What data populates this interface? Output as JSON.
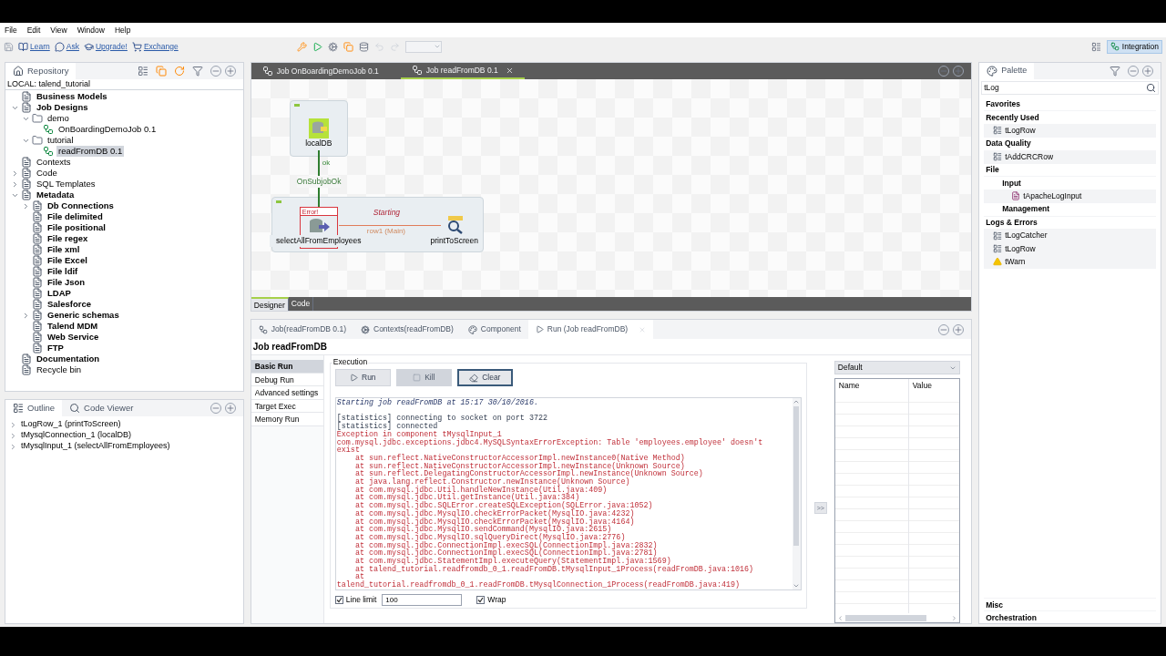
{
  "menu": [
    "File",
    "Edit",
    "View",
    "Window",
    "Help"
  ],
  "toolbar": {
    "links": [
      "Learn",
      "Ask",
      "Upgrade!",
      "Exchange"
    ],
    "perspective": {
      "label": "Integration",
      "selected": true
    }
  },
  "repository": {
    "title": "Repository",
    "project": "LOCAL: talend_tutorial",
    "tree": [
      {
        "label": "Business Models",
        "bold": true,
        "kind": "node",
        "selected": false
      },
      {
        "label": "Job Designs",
        "bold": true,
        "kind": "node",
        "selected": false,
        "expanded": true,
        "children": [
          {
            "label": "demo",
            "bold": false,
            "kind": "folder",
            "selected": false,
            "expanded": true,
            "children": [
              {
                "label": "OnBoardingDemoJob 0.1",
                "bold": false,
                "kind": "job",
                "selected": false
              }
            ]
          },
          {
            "label": "tutorial",
            "bold": false,
            "kind": "folder",
            "selected": false,
            "expanded": true,
            "children": [
              {
                "label": "readFromDB 0.1",
                "bold": false,
                "kind": "job",
                "selected": true
              }
            ]
          }
        ]
      },
      {
        "label": "Contexts",
        "bold": false,
        "kind": "node",
        "selected": false
      },
      {
        "label": "Code",
        "bold": false,
        "kind": "node",
        "selected": false,
        "expanded": false
      },
      {
        "label": "SQL Templates",
        "bold": false,
        "kind": "node",
        "selected": false,
        "expanded": false
      },
      {
        "label": "Metadata",
        "bold": true,
        "kind": "node",
        "selected": false,
        "expanded": true,
        "children": [
          {
            "label": "Db Connections",
            "bold": true,
            "kind": "node",
            "selected": false,
            "expanded": false
          },
          {
            "label": "File delimited",
            "bold": true,
            "kind": "node",
            "selected": false
          },
          {
            "label": "File positional",
            "bold": true,
            "kind": "node",
            "selected": false
          },
          {
            "label": "File regex",
            "bold": true,
            "kind": "node",
            "selected": false
          },
          {
            "label": "File xml",
            "bold": true,
            "kind": "node",
            "selected": false
          },
          {
            "label": "File Excel",
            "bold": true,
            "kind": "node",
            "selected": false
          },
          {
            "label": "File ldif",
            "bold": true,
            "kind": "node",
            "selected": false
          },
          {
            "label": "File Json",
            "bold": true,
            "kind": "node",
            "selected": false
          },
          {
            "label": "LDAP",
            "bold": true,
            "kind": "node",
            "selected": false
          },
          {
            "label": "Salesforce",
            "bold": true,
            "kind": "node",
            "selected": false
          },
          {
            "label": "Generic schemas",
            "bold": true,
            "kind": "node",
            "selected": false,
            "expanded": false
          },
          {
            "label": "Talend MDM",
            "bold": true,
            "kind": "node",
            "selected": false
          },
          {
            "label": "Web Service",
            "bold": true,
            "kind": "node",
            "selected": false
          },
          {
            "label": "FTP",
            "bold": true,
            "kind": "node",
            "selected": false
          }
        ]
      },
      {
        "label": "Documentation",
        "bold": true,
        "kind": "node",
        "selected": false
      },
      {
        "label": "Recycle bin",
        "bold": false,
        "kind": "node",
        "selected": false
      }
    ]
  },
  "outline": {
    "tabs": [
      {
        "label": "Outline",
        "selected": true
      },
      {
        "label": "Code Viewer",
        "selected": false
      }
    ],
    "items": [
      {
        "label": "tLogRow_1 (printToScreen)",
        "expanded": false
      },
      {
        "label": "tMysqlConnection_1 (localDB)",
        "expanded": false
      },
      {
        "label": "tMysqlInput_1 (selectAllFromEmployees)",
        "expanded": false
      }
    ]
  },
  "editor": {
    "tabs": [
      {
        "label": "Job OnBoardingDemoJob 0.1",
        "selected": false
      },
      {
        "label": "Job readFromDB 0.1",
        "selected": true
      }
    ],
    "canvas": {
      "status": "Starting",
      "nodes": [
        {
          "label": "localDB",
          "kind": "connection"
        },
        {
          "label": "selectAllFromEmployees",
          "kind": "input",
          "error": "Error!"
        },
        {
          "label": "printToScreen",
          "kind": "output"
        }
      ],
      "links": [
        {
          "label": "ok",
          "caption": "OnSubjobOk",
          "kind": "trigger"
        },
        {
          "label": "row1 (Main)",
          "kind": "row"
        }
      ]
    },
    "view_tabs": [
      {
        "label": "Designer",
        "selected": true
      },
      {
        "label": "Code",
        "selected": false
      }
    ]
  },
  "run": {
    "tabs": [
      {
        "label": "Job(readFromDB 0.1)",
        "selected": false
      },
      {
        "label": "Contexts(readFromDB)",
        "selected": false
      },
      {
        "label": "Component",
        "selected": false
      },
      {
        "label": "Run (Job readFromDB)",
        "selected": true
      }
    ],
    "title": "Job readFromDB",
    "nav": [
      {
        "label": "Basic Run",
        "selected": true
      },
      {
        "label": "Debug Run",
        "selected": false
      },
      {
        "label": "Advanced settings",
        "selected": false
      },
      {
        "label": "Target Exec",
        "selected": false
      },
      {
        "label": "Memory Run",
        "selected": false
      }
    ],
    "execution": "Execution",
    "buttons": [
      {
        "label": "Run",
        "kind": "run",
        "disabled": false,
        "focused": false
      },
      {
        "label": "Kill",
        "kind": "kill",
        "disabled": true,
        "focused": false
      },
      {
        "label": "Clear",
        "kind": "clear",
        "disabled": false,
        "focused": true
      }
    ],
    "console": [
      {
        "kind": "start",
        "text": "Starting job readFromDB at 15:17 30/10/2016."
      },
      {
        "kind": "stat",
        "text": "[statistics] connecting to socket on port 3722"
      },
      {
        "kind": "stat",
        "text": "[statistics] connected"
      },
      {
        "kind": "error",
        "text": "Exception in component tMysqlInput_1"
      },
      {
        "kind": "error",
        "text": "com.mysql.jdbc.exceptions.jdbc4.MySQLSyntaxErrorException: Table 'employees.employee' doesn't"
      },
      {
        "kind": "error",
        "text": "exist"
      },
      {
        "kind": "error",
        "text": "    at sun.reflect.NativeConstructorAccessorImpl.newInstance0(Native Method)"
      },
      {
        "kind": "error",
        "text": "    at sun.reflect.NativeConstructorAccessorImpl.newInstance(Unknown Source)"
      },
      {
        "kind": "error",
        "text": "    at sun.reflect.DelegatingConstructorAccessorImpl.newInstance(Unknown Source)"
      },
      {
        "kind": "error",
        "text": "    at java.lang.reflect.Constructor.newInstance(Unknown Source)"
      },
      {
        "kind": "error",
        "text": "    at com.mysql.jdbc.Util.handleNewInstance(Util.java:409)"
      },
      {
        "kind": "error",
        "text": "    at com.mysql.jdbc.Util.getInstance(Util.java:384)"
      },
      {
        "kind": "error",
        "text": "    at com.mysql.jdbc.SQLError.createSQLException(SQLError.java:1052)"
      },
      {
        "kind": "error",
        "text": "    at com.mysql.jdbc.MysqlIO.checkErrorPacket(MysqlIO.java:4232)"
      },
      {
        "kind": "error",
        "text": "    at com.mysql.jdbc.MysqlIO.checkErrorPacket(MysqlIO.java:4164)"
      },
      {
        "kind": "error",
        "text": "    at com.mysql.jdbc.MysqlIO.sendCommand(MysqlIO.java:2615)"
      },
      {
        "kind": "error",
        "text": "    at com.mysql.jdbc.MysqlIO.sqlQueryDirect(MysqlIO.java:2776)"
      },
      {
        "kind": "error",
        "text": "    at com.mysql.jdbc.ConnectionImpl.execSQL(ConnectionImpl.java:2832)"
      },
      {
        "kind": "error",
        "text": "    at com.mysql.jdbc.ConnectionImpl.execSQL(ConnectionImpl.java:2781)"
      },
      {
        "kind": "error",
        "text": "    at com.mysql.jdbc.StatementImpl.executeQuery(StatementImpl.java:1569)"
      },
      {
        "kind": "error",
        "text": "    at talend_tutorial.readfromdb_0_1.readFromDB.tMysqlInput_1Process(readFromDB.java:1016)"
      },
      {
        "kind": "error",
        "text": "    at"
      },
      {
        "kind": "error",
        "text": "talend_tutorial.readfromdb_0_1.readFromDB.tMysqlConnection_1Process(readFromDB.java:419)"
      }
    ],
    "line_limit": {
      "label": "Line limit",
      "checked": true,
      "value": "100"
    },
    "wrap": {
      "label": "Wrap",
      "checked": true
    },
    "expand_button": ">>",
    "context": {
      "selected": "Default",
      "columns": [
        "Name",
        "Value"
      ]
    }
  },
  "palette": {
    "title": "Palette",
    "search": "tLog",
    "items": [
      {
        "kind": "category",
        "label": "Favorites"
      },
      {
        "kind": "category",
        "label": "Recently Used"
      },
      {
        "kind": "component",
        "label": "tLogRow"
      },
      {
        "kind": "category",
        "label": "Data Quality"
      },
      {
        "kind": "component",
        "label": "tAddCRCRow"
      },
      {
        "kind": "category",
        "label": "File"
      },
      {
        "kind": "subcategory",
        "label": "Input"
      },
      {
        "kind": "subcomponent",
        "label": "tApacheLogInput"
      },
      {
        "kind": "subcategory",
        "label": "Management"
      },
      {
        "kind": "category",
        "label": "Logs & Errors"
      },
      {
        "kind": "component",
        "label": "tLogCatcher"
      },
      {
        "kind": "component",
        "label": "tLogRow"
      },
      {
        "kind": "warning",
        "label": "tWarn"
      }
    ],
    "footer": [
      "Misc",
      "Orchestration"
    ]
  }
}
